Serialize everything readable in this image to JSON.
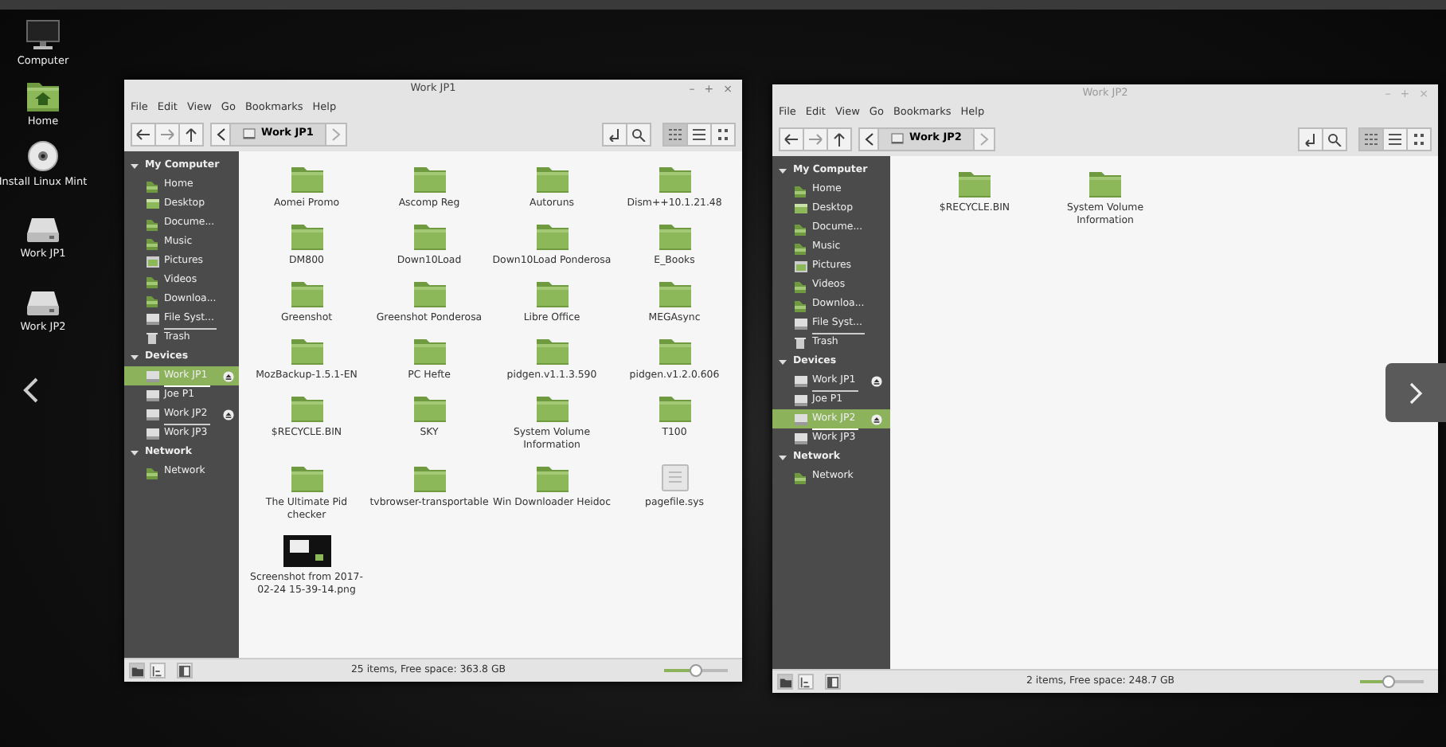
{
  "desktop_icons": [
    {
      "label": "Computer",
      "kind": "computer"
    },
    {
      "label": "Home",
      "kind": "home"
    },
    {
      "label": "Install Linux Mint",
      "kind": "disc"
    },
    {
      "label": "Work JP1",
      "kind": "drive"
    },
    {
      "label": "Work JP2",
      "kind": "drive"
    }
  ],
  "windows": [
    {
      "title": "Work JP1",
      "active": true,
      "controls": [
        "–",
        "+",
        "×"
      ],
      "menu": [
        "File",
        "Edit",
        "View",
        "Go",
        "Bookmarks",
        "Help"
      ],
      "path": "Work JP1",
      "view_buttons": [
        {
          "kind": "icons",
          "selected": true
        },
        {
          "kind": "list",
          "selected": false
        },
        {
          "kind": "compact",
          "selected": false
        }
      ],
      "sidebar": [
        {
          "heading": "My Computer",
          "expanded": true,
          "items": [
            {
              "label": "Home",
              "kind": "home",
              "selected": false,
              "eject": false,
              "usage_bar": false
            },
            {
              "label": "Desktop",
              "kind": "desktop",
              "selected": false,
              "eject": false,
              "usage_bar": false
            },
            {
              "label": "Docume...",
              "kind": "documents",
              "selected": false,
              "eject": false,
              "usage_bar": false
            },
            {
              "label": "Music",
              "kind": "music",
              "selected": false,
              "eject": false,
              "usage_bar": false
            },
            {
              "label": "Pictures",
              "kind": "pictures",
              "selected": false,
              "eject": false,
              "usage_bar": false
            },
            {
              "label": "Videos",
              "kind": "videos",
              "selected": false,
              "eject": false,
              "usage_bar": false
            },
            {
              "label": "Downloa...",
              "kind": "downloads",
              "selected": false,
              "eject": false,
              "usage_bar": false
            },
            {
              "label": "File Syst...",
              "kind": "drive",
              "selected": false,
              "eject": false,
              "usage_bar": true
            },
            {
              "label": "Trash",
              "kind": "trash",
              "selected": false,
              "eject": false,
              "usage_bar": false
            }
          ]
        },
        {
          "heading": "Devices",
          "expanded": true,
          "items": [
            {
              "label": "Work JP1",
              "kind": "drive",
              "selected": true,
              "eject": true,
              "usage_bar": true
            },
            {
              "label": "Joe P1",
              "kind": "drive",
              "selected": false,
              "eject": false,
              "usage_bar": false
            },
            {
              "label": "Work JP2",
              "kind": "drive",
              "selected": false,
              "eject": true,
              "usage_bar": true
            },
            {
              "label": "Work JP3",
              "kind": "drive",
              "selected": false,
              "eject": false,
              "usage_bar": false
            }
          ]
        },
        {
          "heading": "Network",
          "expanded": true,
          "items": [
            {
              "label": "Network",
              "kind": "network",
              "selected": false,
              "eject": false,
              "usage_bar": false
            }
          ]
        }
      ],
      "files": [
        {
          "name": "Aomei Promo",
          "kind": "folder"
        },
        {
          "name": "Ascomp Reg",
          "kind": "folder"
        },
        {
          "name": "Autoruns",
          "kind": "folder"
        },
        {
          "name": "Dism++10.1.21.48",
          "kind": "folder"
        },
        {
          "name": "DM800",
          "kind": "folder"
        },
        {
          "name": "Down10Load",
          "kind": "folder"
        },
        {
          "name": "Down10Load Ponderosa",
          "kind": "folder"
        },
        {
          "name": "E_Books",
          "kind": "folder"
        },
        {
          "name": "Greenshot",
          "kind": "folder"
        },
        {
          "name": "Greenshot Ponderosa",
          "kind": "folder"
        },
        {
          "name": "Libre Office",
          "kind": "folder"
        },
        {
          "name": "MEGAsync",
          "kind": "folder"
        },
        {
          "name": "MozBackup-1.5.1-EN",
          "kind": "folder"
        },
        {
          "name": "PC Hefte",
          "kind": "folder"
        },
        {
          "name": "pidgen.v1.1.3.590",
          "kind": "folder"
        },
        {
          "name": "pidgen.v1.2.0.606",
          "kind": "folder"
        },
        {
          "name": "$RECYCLE.BIN",
          "kind": "folder"
        },
        {
          "name": "SKY",
          "kind": "folder"
        },
        {
          "name": "System Volume Information",
          "kind": "folder"
        },
        {
          "name": "T100",
          "kind": "folder"
        },
        {
          "name": "The Ultimate Pid checker",
          "kind": "folder"
        },
        {
          "name": "tvbrowser-transportable",
          "kind": "folder"
        },
        {
          "name": "Win Downloader Heidoc",
          "kind": "folder"
        },
        {
          "name": "pagefile.sys",
          "kind": "file"
        },
        {
          "name": "Screenshot from 2017-02-24 15-39-14.png",
          "kind": "image"
        }
      ],
      "status_buttons": [
        {
          "kind": "places",
          "selected": true
        },
        {
          "kind": "tree",
          "selected": false
        },
        {
          "kind": "panel",
          "selected": false
        }
      ],
      "status": "25 items, Free space: 363.8 GB",
      "zoom": {
        "level": 0.5
      }
    },
    {
      "title": "Work JP2",
      "active": false,
      "controls": [
        "–",
        "+",
        "×"
      ],
      "menu": [
        "File",
        "Edit",
        "View",
        "Go",
        "Bookmarks",
        "Help"
      ],
      "path": "Work JP2",
      "view_buttons": [
        {
          "kind": "icons",
          "selected": true
        },
        {
          "kind": "list",
          "selected": false
        },
        {
          "kind": "compact",
          "selected": false
        }
      ],
      "sidebar": [
        {
          "heading": "My Computer",
          "expanded": true,
          "items": [
            {
              "label": "Home",
              "kind": "home",
              "selected": false,
              "eject": false,
              "usage_bar": false
            },
            {
              "label": "Desktop",
              "kind": "desktop",
              "selected": false,
              "eject": false,
              "usage_bar": false
            },
            {
              "label": "Docume...",
              "kind": "documents",
              "selected": false,
              "eject": false,
              "usage_bar": false
            },
            {
              "label": "Music",
              "kind": "music",
              "selected": false,
              "eject": false,
              "usage_bar": false
            },
            {
              "label": "Pictures",
              "kind": "pictures",
              "selected": false,
              "eject": false,
              "usage_bar": false
            },
            {
              "label": "Videos",
              "kind": "videos",
              "selected": false,
              "eject": false,
              "usage_bar": false
            },
            {
              "label": "Downloa...",
              "kind": "downloads",
              "selected": false,
              "eject": false,
              "usage_bar": false
            },
            {
              "label": "File Syst...",
              "kind": "drive",
              "selected": false,
              "eject": false,
              "usage_bar": true
            },
            {
              "label": "Trash",
              "kind": "trash",
              "selected": false,
              "eject": false,
              "usage_bar": false
            }
          ]
        },
        {
          "heading": "Devices",
          "expanded": true,
          "items": [
            {
              "label": "Work JP1",
              "kind": "drive",
              "selected": false,
              "eject": true,
              "usage_bar": true
            },
            {
              "label": "Joe P1",
              "kind": "drive",
              "selected": false,
              "eject": false,
              "usage_bar": false
            },
            {
              "label": "Work JP2",
              "kind": "drive",
              "selected": true,
              "eject": true,
              "usage_bar": true
            },
            {
              "label": "Work JP3",
              "kind": "drive",
              "selected": false,
              "eject": false,
              "usage_bar": false
            }
          ]
        },
        {
          "heading": "Network",
          "expanded": true,
          "items": [
            {
              "label": "Network",
              "kind": "network",
              "selected": false,
              "eject": false,
              "usage_bar": false
            }
          ]
        }
      ],
      "files": [
        {
          "name": "$RECYCLE.BIN",
          "kind": "folder"
        },
        {
          "name": "System Volume Information",
          "kind": "folder"
        }
      ],
      "status_buttons": [
        {
          "kind": "places",
          "selected": true
        },
        {
          "kind": "tree",
          "selected": false
        },
        {
          "kind": "panel",
          "selected": false
        }
      ],
      "status": "2 items, Free space: 248.7 GB",
      "zoom": {
        "level": 0.45
      }
    }
  ]
}
